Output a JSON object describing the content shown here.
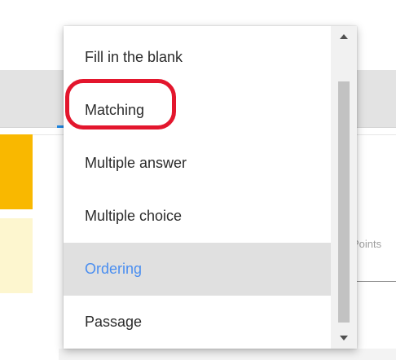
{
  "background": {
    "points_label": "Points"
  },
  "dropdown": {
    "options": [
      {
        "label": "Fill in the blank"
      },
      {
        "label": "Matching"
      },
      {
        "label": "Multiple answer"
      },
      {
        "label": "Multiple choice"
      },
      {
        "label": "Ordering"
      },
      {
        "label": "Passage"
      }
    ],
    "selected_label": "Ordering",
    "highlighted_label": "Matching"
  },
  "colors": {
    "selected_text": "#4a8ef0",
    "selected_bg": "#e0e0e0",
    "annotation_ring": "#e3162d",
    "tab_indicator": "#1e88e5",
    "accent_yellow": "#f9b800",
    "accent_cream": "#fdf6cf"
  },
  "icons": {
    "scroll_up": "triangle-up",
    "scroll_down": "triangle-down"
  }
}
